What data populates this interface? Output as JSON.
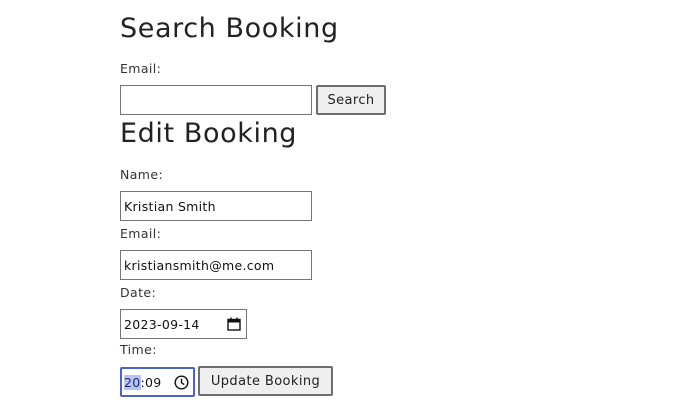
{
  "search": {
    "heading": "Search Booking",
    "email_label": "Email:",
    "email_value": "",
    "button_label": "Search"
  },
  "edit": {
    "heading": "Edit Booking",
    "name_label": "Name:",
    "name_value": "Kristian Smith",
    "email_label": "Email:",
    "email_value": "kristiansmith@me.com",
    "date_label": "Date:",
    "date_value": "2023-09-14",
    "time_label": "Time:",
    "time_hour": "20",
    "time_sep": ":",
    "time_minute": "09",
    "button_label": "Update Booking"
  },
  "icons": {
    "date": "calendar-icon",
    "time": "clock-icon"
  },
  "colors": {
    "focus_ring": "#4a63c9",
    "selection": "#b9c3ef"
  }
}
